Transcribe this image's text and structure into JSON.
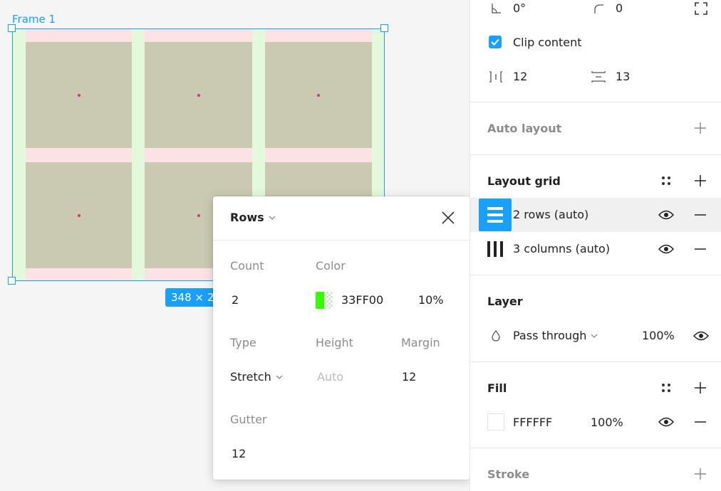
{
  "canvas": {
    "frame_label": "Frame 1",
    "size_badge": "348 × 236"
  },
  "popup": {
    "title": "Rows",
    "labels": {
      "count": "Count",
      "color": "Color",
      "type": "Type",
      "height": "Height",
      "margin": "Margin",
      "gutter": "Gutter"
    },
    "values": {
      "count": "2",
      "color_hex": "33FF00",
      "opacity": "10%",
      "type": "Stretch",
      "height": "Auto",
      "margin": "12",
      "gutter": "12"
    },
    "swatch_color": "#33ff00"
  },
  "panel": {
    "rotation": "0°",
    "corner_radius": "0",
    "clip_content": "Clip content",
    "horizontal_spacing": "12",
    "vertical_spacing": "13",
    "auto_layout": "Auto layout",
    "layout_grid": {
      "title": "Layout grid",
      "items": [
        {
          "label": "2 rows (auto)",
          "selected": true
        },
        {
          "label": "3 columns (auto)",
          "selected": false
        }
      ]
    },
    "layer": {
      "title": "Layer",
      "blend_mode": "Pass through",
      "opacity": "100%"
    },
    "fill": {
      "title": "Fill",
      "hex": "FFFFFF",
      "opacity": "100%"
    },
    "stroke": {
      "title": "Stroke"
    }
  },
  "colors": {
    "accent": "#18a0fb",
    "row_band": "#fbe3e5",
    "column_band": "#e4f9dc",
    "cell": "#cac9b1"
  },
  "icons": [
    "rotation-icon",
    "corner-radius-icon",
    "independent-corners-icon",
    "checkbox-checked-icon",
    "horizontal-spacing-icon",
    "vertical-spacing-icon",
    "plus-icon",
    "style-dots-icon",
    "rows-grid-icon",
    "columns-grid-icon",
    "eye-icon",
    "minus-icon",
    "blend-drop-icon",
    "chevron-down-icon",
    "close-icon"
  ]
}
